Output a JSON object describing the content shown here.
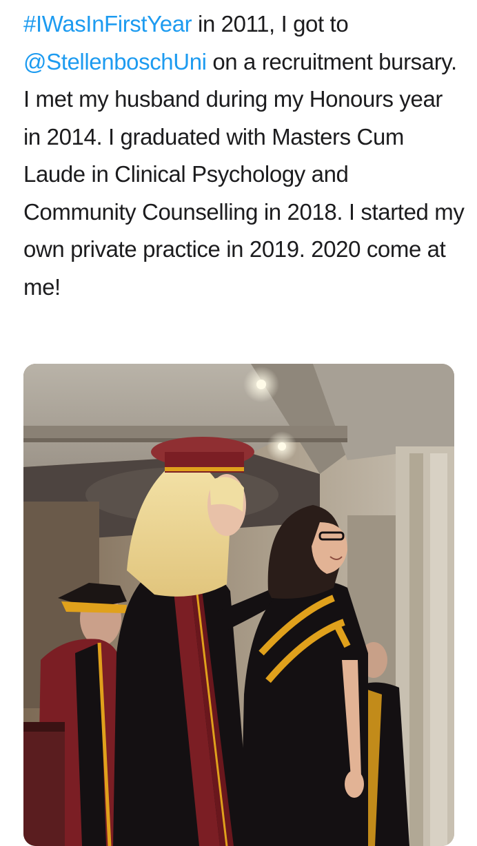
{
  "tweet": {
    "hashtag": "#IWasInFirstYear",
    "text_1": " in 2011, I got to ",
    "mention": "@StellenboschUni",
    "text_2": " on a recruitment bursary. I met my husband during my Honours year in 2014. I graduated with Masters Cum Laude in Clinical Psychology and Community Counselling in 2018. I started my own private practice in 2019. 2020 come at me!"
  },
  "media": {
    "image_kind": "photo"
  },
  "colors": {
    "link": "#1d9bf0",
    "text": "#1c1c1e",
    "gown_maroon": "#7b1e24",
    "gown_black": "#141012",
    "gold_trim": "#e0a11c"
  }
}
